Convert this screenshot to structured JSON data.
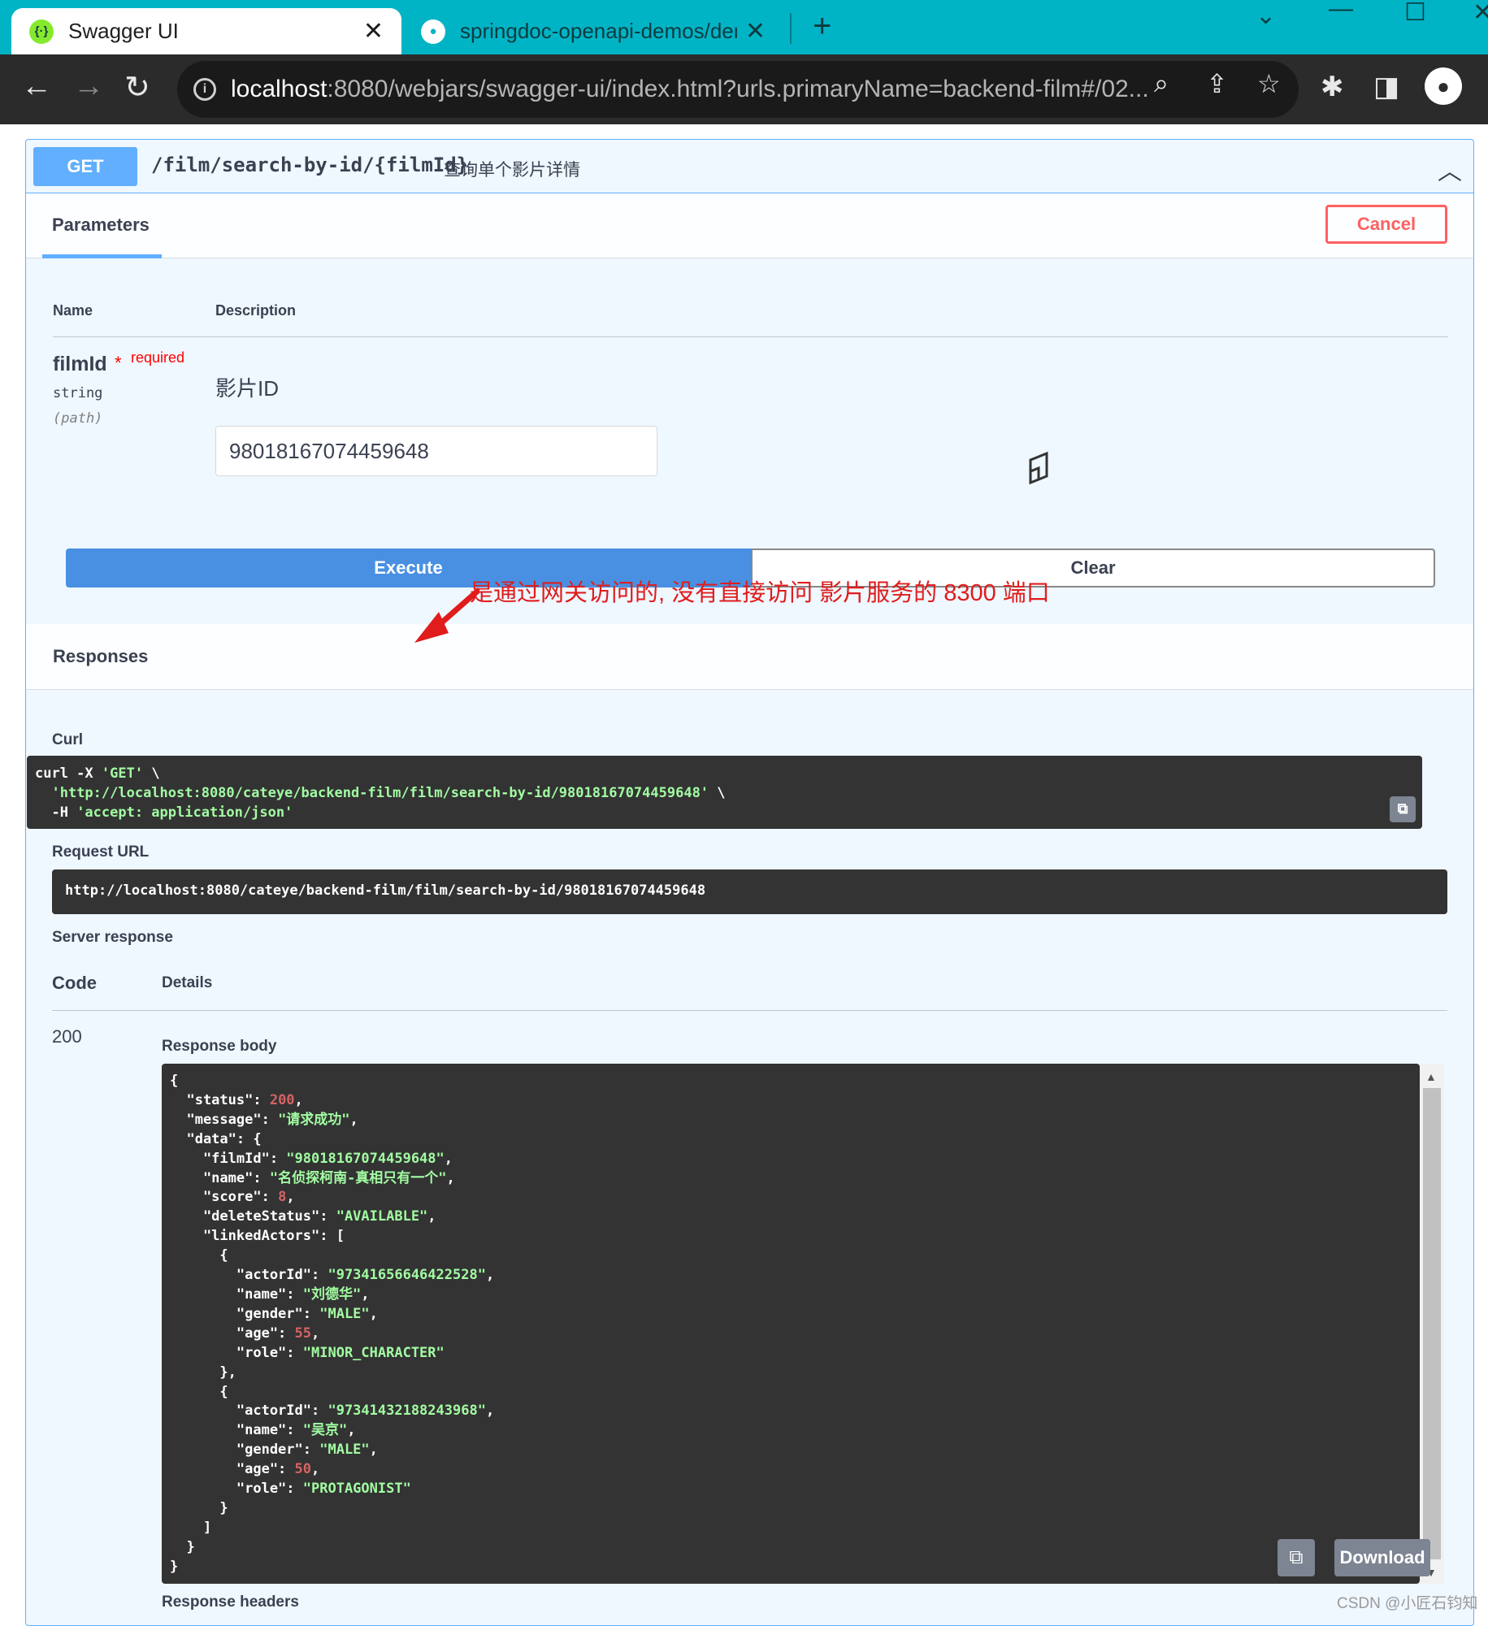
{
  "browser": {
    "tabs": [
      {
        "title": "Swagger UI",
        "close": "✕"
      },
      {
        "title": "springdoc-openapi-demos/den",
        "close": "✕"
      }
    ],
    "new_tab": "+",
    "url_host": "localhost",
    "url_path": ":8080/webjars/swagger-ui/index.html?urls.primaryName=backend-film#/02..."
  },
  "operation": {
    "method": "GET",
    "path": "/film/search-by-id/{filmId}",
    "summary": "查询单个影片详情"
  },
  "parameters": {
    "tab_label": "Parameters",
    "cancel_label": "Cancel",
    "col_name": "Name",
    "col_description": "Description",
    "param": {
      "name": "filmId",
      "star": "*",
      "required": "required",
      "type": "string",
      "in": "(path)",
      "description": "影片ID",
      "value": "98018167074459648"
    },
    "execute_label": "Execute",
    "clear_label": "Clear"
  },
  "responses": {
    "title": "Responses",
    "curl_label": "Curl",
    "annotation": "是通过网关访问的, 没有直接访问 影片服务的 8300 端口",
    "curl_lines": [
      [
        "curl -X ",
        "'GET'",
        " \\"
      ],
      [
        "  ",
        "'http://localhost:8080/cateye/backend-film/film/search-by-id/98018167074459648'",
        " \\"
      ],
      [
        "  -H ",
        "'accept: application/json'",
        ""
      ]
    ],
    "request_url_label": "Request URL",
    "request_url": "http://localhost:8080/cateye/backend-film/film/search-by-id/98018167074459648",
    "server_response_label": "Server response",
    "code_head": "Code",
    "details_head": "Details",
    "status_code": "200",
    "response_body_label": "Response body",
    "body_lines": [
      [
        [
          "p",
          "{"
        ]
      ],
      [
        [
          "p",
          "  \"status\": "
        ],
        [
          "n",
          "200"
        ],
        [
          "p",
          ","
        ]
      ],
      [
        [
          "p",
          "  \"message\": "
        ],
        [
          "s",
          "\"请求成功\""
        ],
        [
          "p",
          ","
        ]
      ],
      [
        [
          "p",
          "  \"data\": {"
        ]
      ],
      [
        [
          "p",
          "    \"filmId\": "
        ],
        [
          "s",
          "\"98018167074459648\""
        ],
        [
          "p",
          ","
        ]
      ],
      [
        [
          "p",
          "    \"name\": "
        ],
        [
          "s",
          "\"名侦探柯南-真相只有一个\""
        ],
        [
          "p",
          ","
        ]
      ],
      [
        [
          "p",
          "    \"score\": "
        ],
        [
          "n",
          "8"
        ],
        [
          "p",
          ","
        ]
      ],
      [
        [
          "p",
          "    \"deleteStatus\": "
        ],
        [
          "s",
          "\"AVAILABLE\""
        ],
        [
          "p",
          ","
        ]
      ],
      [
        [
          "p",
          "    \"linkedActors\": ["
        ]
      ],
      [
        [
          "p",
          "      {"
        ]
      ],
      [
        [
          "p",
          "        \"actorId\": "
        ],
        [
          "s",
          "\"97341656646422528\""
        ],
        [
          "p",
          ","
        ]
      ],
      [
        [
          "p",
          "        \"name\": "
        ],
        [
          "s",
          "\"刘德华\""
        ],
        [
          "p",
          ","
        ]
      ],
      [
        [
          "p",
          "        \"gender\": "
        ],
        [
          "s",
          "\"MALE\""
        ],
        [
          "p",
          ","
        ]
      ],
      [
        [
          "p",
          "        \"age\": "
        ],
        [
          "n",
          "55"
        ],
        [
          "p",
          ","
        ]
      ],
      [
        [
          "p",
          "        \"role\": "
        ],
        [
          "s",
          "\"MINOR_CHARACTER\""
        ]
      ],
      [
        [
          "p",
          "      },"
        ]
      ],
      [
        [
          "p",
          "      {"
        ]
      ],
      [
        [
          "p",
          "        \"actorId\": "
        ],
        [
          "s",
          "\"97341432188243968\""
        ],
        [
          "p",
          ","
        ]
      ],
      [
        [
          "p",
          "        \"name\": "
        ],
        [
          "s",
          "\"吴京\""
        ],
        [
          "p",
          ","
        ]
      ],
      [
        [
          "p",
          "        \"gender\": "
        ],
        [
          "s",
          "\"MALE\""
        ],
        [
          "p",
          ","
        ]
      ],
      [
        [
          "p",
          "        \"age\": "
        ],
        [
          "n",
          "50"
        ],
        [
          "p",
          ","
        ]
      ],
      [
        [
          "p",
          "        \"role\": "
        ],
        [
          "s",
          "\"PROTAGONIST\""
        ]
      ],
      [
        [
          "p",
          "      }"
        ]
      ],
      [
        [
          "p",
          "    ]"
        ]
      ],
      [
        [
          "p",
          "  }"
        ]
      ],
      [
        [
          "p",
          "}"
        ]
      ]
    ],
    "download_label": "Download",
    "response_headers_label": "Response headers"
  },
  "watermark": "CSDN @小匠石钧知",
  "colors": {
    "get": "#61affe",
    "execute": "#4990e2",
    "cancel": "#ff6060",
    "tab_bar": "#00b4c5",
    "json_string": "#a2fca2",
    "json_number": "#d36363"
  }
}
